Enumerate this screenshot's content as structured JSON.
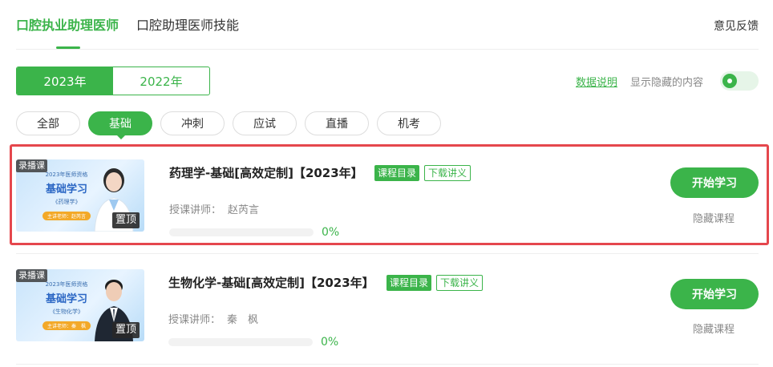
{
  "top_tabs": [
    "口腔执业助理医师",
    "口腔助理医师技能"
  ],
  "feedback": "意见反馈",
  "year_tabs": [
    "2023年",
    "2022年"
  ],
  "data_link": "数据说明",
  "show_hidden_label": "显示隐藏的内容",
  "categories": [
    "全部",
    "基础",
    "冲刺",
    "应试",
    "直播",
    "机考"
  ],
  "active_category": "基础",
  "courses": [
    {
      "title": "药理学-基础[高效定制]【2023年】",
      "catalog_tag": "课程目录",
      "download_tag": "下载讲义",
      "teacher_label": "授课讲师：",
      "teacher": "赵芮言",
      "progress": "0%",
      "progress_value": 0,
      "start_label": "开始学习",
      "hide_label": "隐藏课程",
      "badge_type": "录播课",
      "badge_pin": "置顶",
      "thumb": {
        "line1": "2023年医师资格",
        "line2": "基础学习",
        "line3": "《药理学》",
        "line4": "主讲老师：赵芮言"
      }
    },
    {
      "title": "生物化学-基础[高效定制]【2023年】",
      "catalog_tag": "课程目录",
      "download_tag": "下载讲义",
      "teacher_label": "授课讲师：",
      "teacher": "秦　枫",
      "progress": "0%",
      "progress_value": 0,
      "start_label": "开始学习",
      "hide_label": "隐藏课程",
      "badge_type": "录播课",
      "badge_pin": "置顶",
      "thumb": {
        "line1": "2023年医师资格",
        "line2": "基础学习",
        "line3": "《生物化学》",
        "line4": "主讲老师：秦　枫"
      }
    }
  ],
  "colors": {
    "accent": "#3bb44a",
    "highlight_border": "#e5474d"
  }
}
